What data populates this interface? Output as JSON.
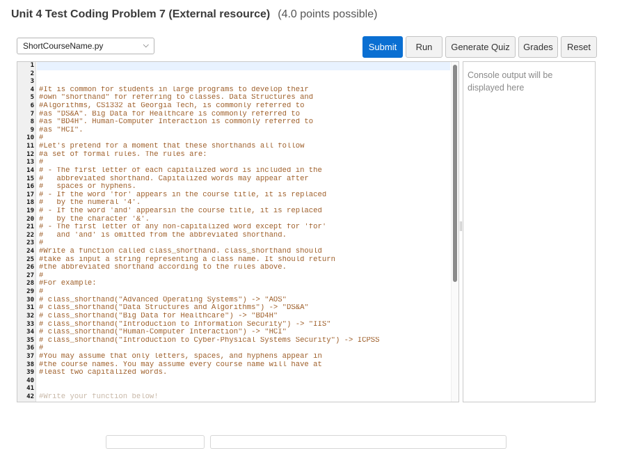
{
  "header": {
    "title": "Unit 4 Test Coding Problem 7 (External resource)",
    "points": "(4.0 points possible)"
  },
  "file_select": {
    "value": "ShortCourseName.py",
    "icon": "chevron-down-icon"
  },
  "toolbar": {
    "submit": "Submit",
    "run": "Run",
    "generate_quiz": "Generate Quiz",
    "grades": "Grades",
    "reset": "Reset"
  },
  "editor": {
    "lines": [
      {
        "n": "1",
        "text": ""
      },
      {
        "n": "2",
        "text": ""
      },
      {
        "n": "3",
        "text": ""
      },
      {
        "n": "4",
        "text": "#It is common for students in large programs to develop their"
      },
      {
        "n": "5",
        "text": "#own \"shorthand\" for referring to classes. Data Structures and"
      },
      {
        "n": "6",
        "text": "#Algorithms, CS1332 at Georgia Tech, is commonly referred to"
      },
      {
        "n": "7",
        "text": "#as \"DS&A\". Big Data for Healthcare is commonly referred to"
      },
      {
        "n": "8",
        "text": "#as \"BD4H\". Human-Computer Interaction is commonly referred to"
      },
      {
        "n": "9",
        "text": "#as \"HCI\"."
      },
      {
        "n": "10",
        "text": "#"
      },
      {
        "n": "11",
        "text": "#Let's pretend for a moment that these shorthands all follow"
      },
      {
        "n": "12",
        "text": "#a set of formal rules. The rules are:"
      },
      {
        "n": "13",
        "text": "#"
      },
      {
        "n": "14",
        "text": "# - The first letter of each capitalized word is included in the"
      },
      {
        "n": "15",
        "text": "#   abbreviated shorthand. Capitalized words may appear after"
      },
      {
        "n": "16",
        "text": "#   spaces or hyphens."
      },
      {
        "n": "17",
        "text": "# - If the word 'for' appears in the course title, it is replaced"
      },
      {
        "n": "18",
        "text": "#   by the numeral '4'."
      },
      {
        "n": "19",
        "text": "# - If the word 'and' appearsin the course title, it is replaced"
      },
      {
        "n": "20",
        "text": "#   by the character '&'."
      },
      {
        "n": "21",
        "text": "# - The first letter of any non-capitalized word except for 'for'"
      },
      {
        "n": "22",
        "text": "#   and 'and' is omitted from the abbreviated shorthand."
      },
      {
        "n": "23",
        "text": "#"
      },
      {
        "n": "24",
        "text": "#Write a function called class_shorthand. class_shorthand should"
      },
      {
        "n": "25",
        "text": "#take as input a string representing a class name. It should return"
      },
      {
        "n": "26",
        "text": "#the abbreviated shorthand according to the rules above."
      },
      {
        "n": "27",
        "text": "#"
      },
      {
        "n": "28",
        "text": "#For example:"
      },
      {
        "n": "29",
        "text": "#"
      },
      {
        "n": "30",
        "text": "# class_shorthand(\"Advanced Operating Systems\") -> \"AOS\""
      },
      {
        "n": "31",
        "text": "# class_shorthand(\"Data Structures and Algorithms\") -> \"DS&A\""
      },
      {
        "n": "32",
        "text": "# class_shorthand(\"Big Data for Healthcare\") -> \"BD4H\""
      },
      {
        "n": "33",
        "text": "# class_shorthand(\"Introduction to Information Security\") -> \"IIS\""
      },
      {
        "n": "34",
        "text": "# class_shorthand(\"Human-Computer Interaction\") -> \"HCI\""
      },
      {
        "n": "35",
        "text": "# class_shorthand(\"Introduction to Cyber-Physical Systems Security\") -> ICPSS"
      },
      {
        "n": "36",
        "text": "#"
      },
      {
        "n": "37",
        "text": "#You may assume that only letters, spaces, and hyphens appear in"
      },
      {
        "n": "38",
        "text": "#the course names. You may assume every course name will have at"
      },
      {
        "n": "39",
        "text": "#least two capitalized words."
      },
      {
        "n": "40",
        "text": ""
      },
      {
        "n": "41",
        "text": ""
      },
      {
        "n": "42",
        "text": "#Write your function below!"
      }
    ]
  },
  "console": {
    "placeholder": "Console output will be displayed here"
  }
}
